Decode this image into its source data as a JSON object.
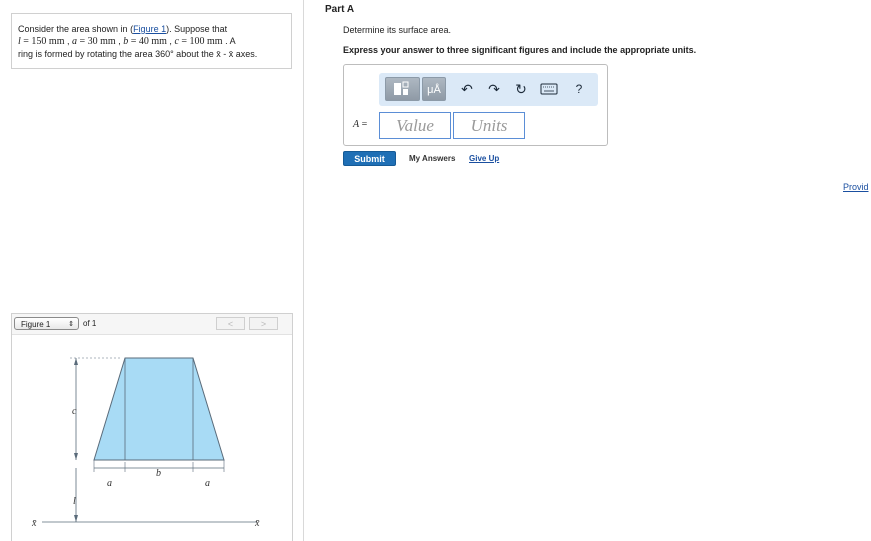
{
  "problem": {
    "intro": "Consider the area shown in (",
    "figure_link": "Figure 1",
    "intro_end": "). Suppose that",
    "l_var": "l",
    "l_val": " = 150  mm",
    "a_var": "a",
    "a_val": " = 30  mm",
    "b_var": "b",
    "b_val": " = 40  mm",
    "c_var": "c",
    "c_val": " = 100  mm",
    "line2_end": " . A",
    "line3": "ring is formed by rotating the area 360° about the x̄ - x̄ axes.",
    "sep": " , "
  },
  "figure": {
    "select_label": "Figure 1",
    "select_arrows": "⇕",
    "of_label": "of 1",
    "prev": "<",
    "next": ">",
    "labels": {
      "c": "c",
      "b": "b",
      "a_left": "a",
      "a_right": "a",
      "l": "l",
      "xbar_left": "x̄",
      "xbar_right": "x̄"
    },
    "colors": {
      "fill": "#a8dbf5",
      "stroke": "#5a6b7a"
    }
  },
  "part": {
    "title": "Part A",
    "instruction": "Determine its surface area.",
    "instruction2": "Express your answer to three significant figures and include the appropriate units."
  },
  "answer": {
    "label_var": "A",
    "label_eq": " =",
    "value_placeholder": "Value",
    "units_placeholder": "Units",
    "toolbar": {
      "template_icon": "template-icon",
      "units_btn": "μÅ",
      "undo_icon": "undo-icon",
      "redo_icon": "redo-icon",
      "reset_icon": "reset-icon",
      "keyboard_icon": "keyboard-icon",
      "help": "?"
    }
  },
  "actions": {
    "submit": "Submit",
    "my_answers": "My Answers",
    "give_up": "Give Up"
  },
  "side_link": "Provid"
}
